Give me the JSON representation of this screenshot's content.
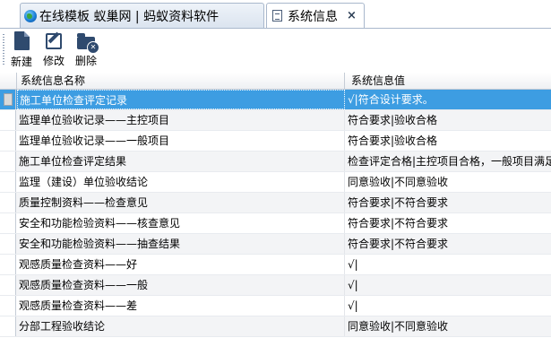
{
  "tabs": [
    {
      "label": "在线模板 蚁巢网 | 蚂蚁资料软件",
      "icon": "globe-icon"
    },
    {
      "label": "系统信息",
      "icon": "document-icon",
      "close": "×"
    }
  ],
  "toolbar": {
    "new_label": "新建",
    "edit_label": "修改",
    "delete_label": "删除"
  },
  "grid": {
    "columns": [
      "系统信息名称",
      "系统信息值"
    ],
    "rows": [
      {
        "name": "施工单位检查评定记录",
        "value": "√|符合设计要求。"
      },
      {
        "name": "监理单位验收记录——主控项目",
        "value": "符合要求|验收合格"
      },
      {
        "name": "监理单位验收记录——一般项目",
        "value": "符合要求|验收合格"
      },
      {
        "name": "施工单位检查评定结果",
        "value": "检查评定合格|主控项目合格，一般项目满足"
      },
      {
        "name": "监理（建设）单位验收结论",
        "value": "同意验收|不同意验收"
      },
      {
        "name": "质量控制资料——检查意见",
        "value": "符合要求|不符合要求"
      },
      {
        "name": "安全和功能检验资料——核查意见",
        "value": "符合要求|不符合要求"
      },
      {
        "name": "安全和功能检验资料——抽查结果",
        "value": "符合要求|不符合要求"
      },
      {
        "name": "观感质量检查资料——好",
        "value": "√|"
      },
      {
        "name": "观感质量检查资料——一般",
        "value": "√|"
      },
      {
        "name": "观感质量检查资料——差",
        "value": "√|"
      },
      {
        "name": "分部工程验收结论",
        "value": "同意验收|不同意验收"
      }
    ],
    "selected_row": 0
  },
  "colors": {
    "selection": "#3d9de2",
    "icon": "#2f4a6e",
    "border": "#a9b8cc"
  }
}
